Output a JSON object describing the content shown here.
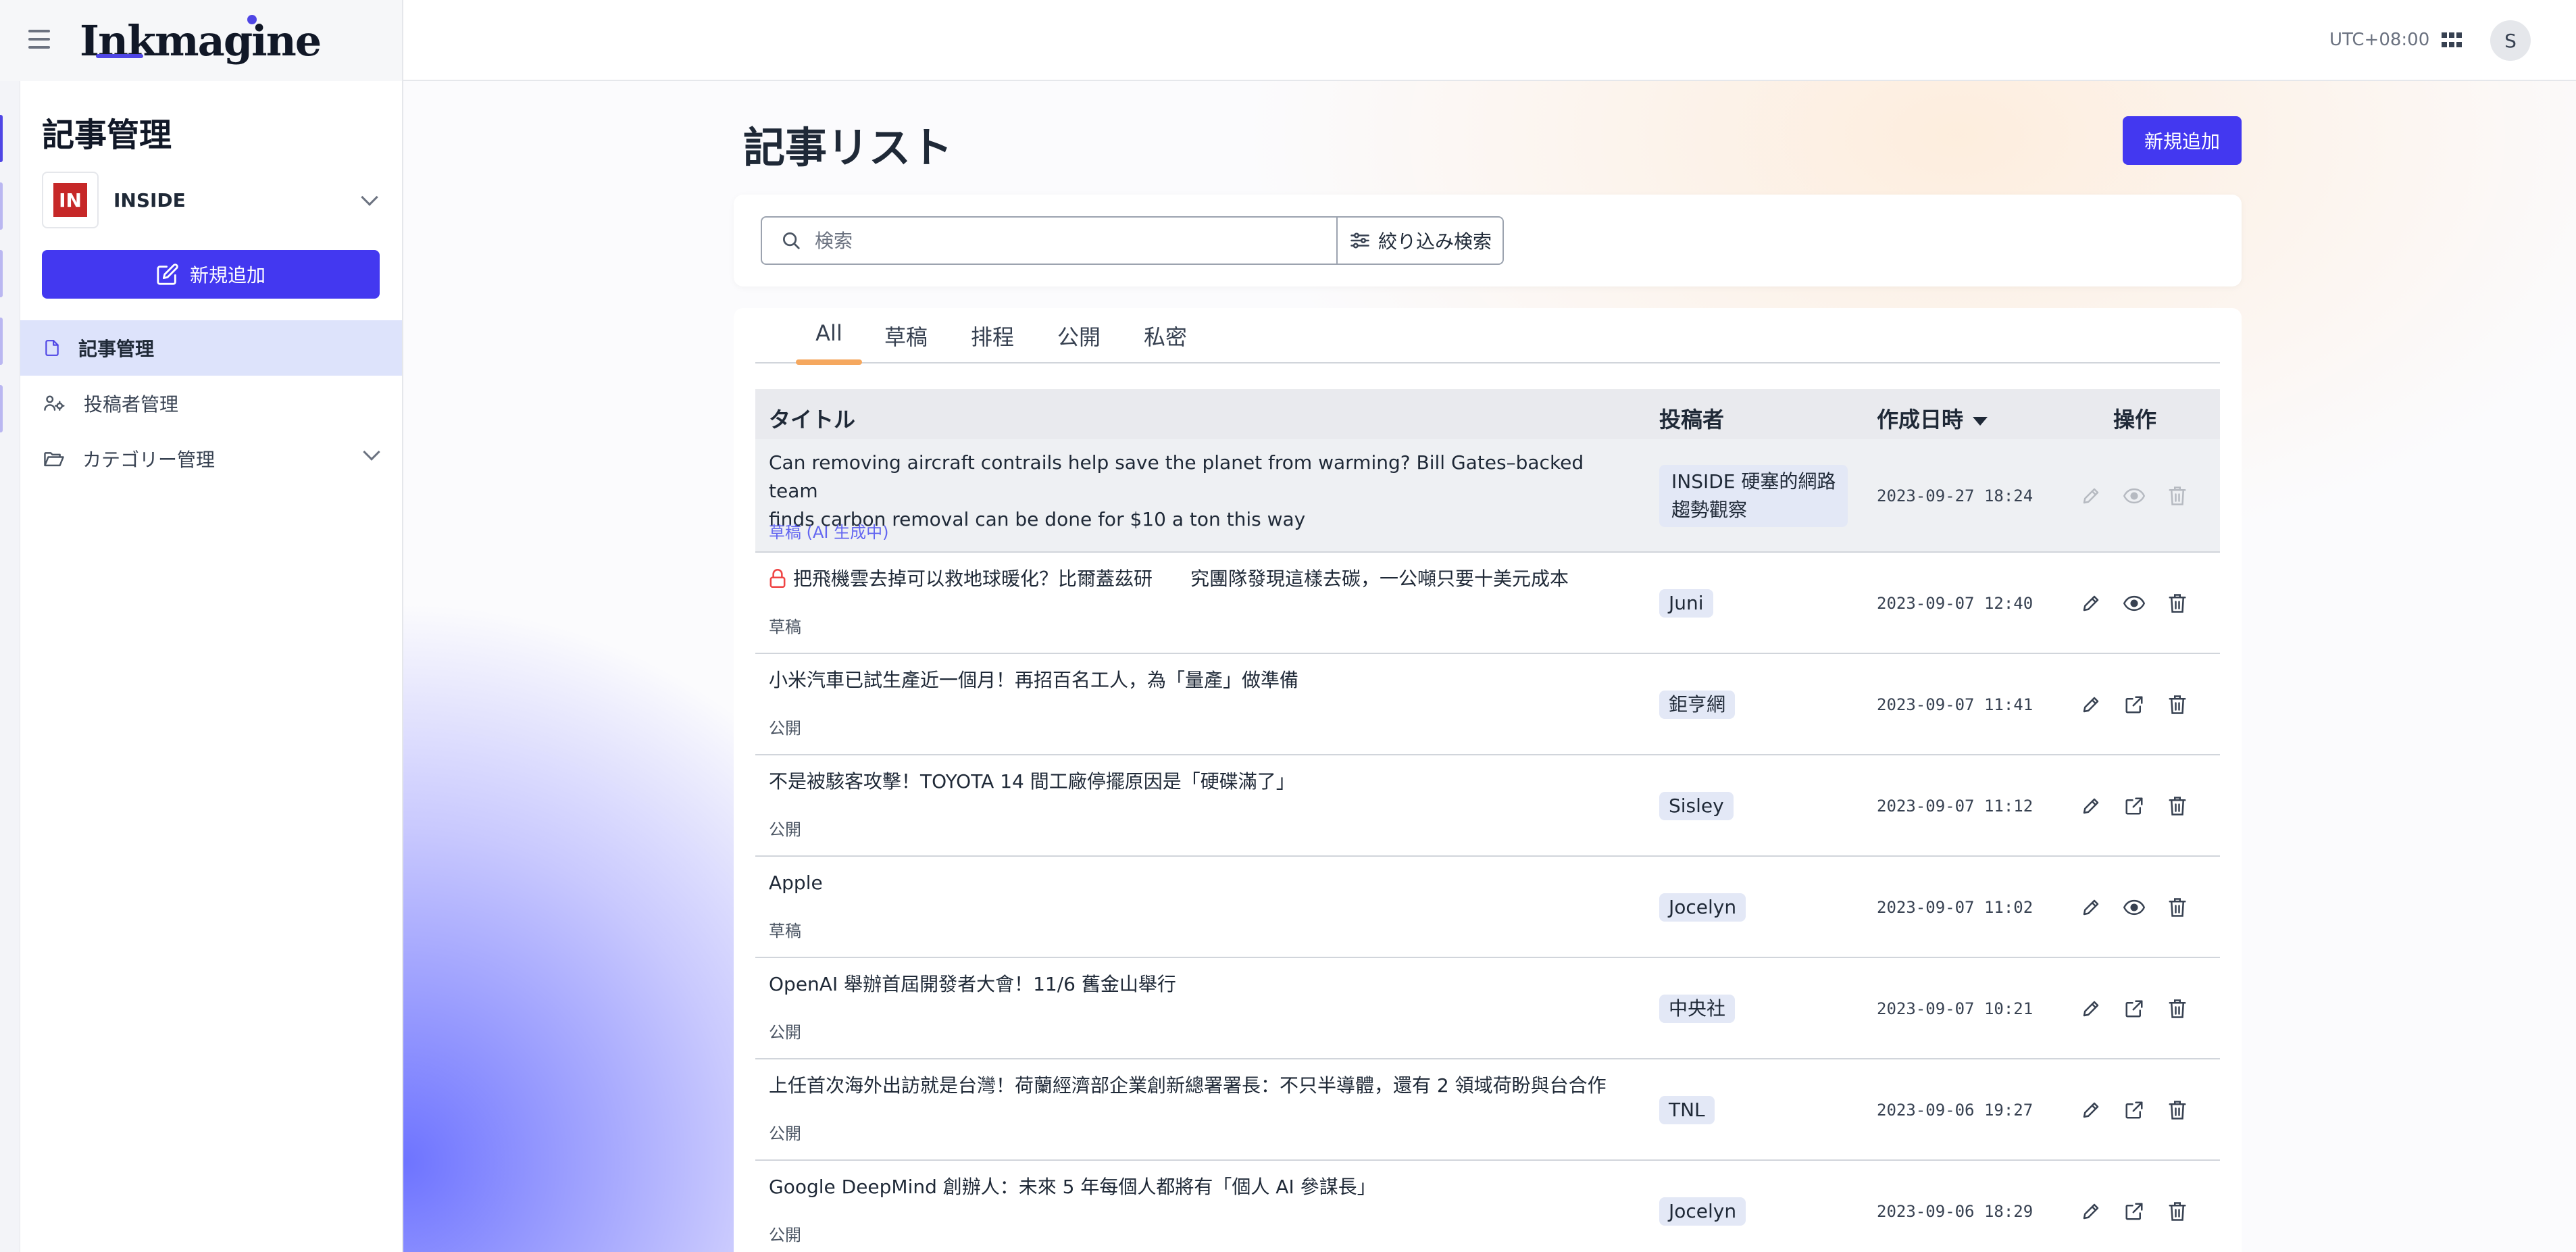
{
  "app": {
    "logo_text": "Inkmagine",
    "timezone": "UTC+08:00",
    "avatar_initial": "S"
  },
  "sidebar": {
    "title": "記事管理",
    "site": {
      "logo": "IN",
      "name": "INSIDE"
    },
    "new_button": "新規追加",
    "items": [
      {
        "label": "記事管理",
        "icon": "document-icon",
        "active": true
      },
      {
        "label": "投稿者管理",
        "icon": "users-gear-icon",
        "active": false
      },
      {
        "label": "カテゴリー管理",
        "icon": "folder-open-icon",
        "active": false
      }
    ]
  },
  "main": {
    "title": "記事リスト",
    "new_button": "新規追加",
    "search": {
      "placeholder": "検索",
      "value": ""
    },
    "filter_button": "絞り込み検索",
    "tabs": [
      {
        "label": "All",
        "active": true
      },
      {
        "label": "草稿",
        "active": false
      },
      {
        "label": "排程",
        "active": false
      },
      {
        "label": "公開",
        "active": false
      },
      {
        "label": "私密",
        "active": false
      }
    ],
    "columns": {
      "title": "タイトル",
      "author": "投稿者",
      "created": "作成日時",
      "actions": "操作"
    },
    "colors": {
      "accent": "#4338f0",
      "tab_indicator": "#f5a85f",
      "ai_status": "#6366f1",
      "lock": "#ef4444"
    },
    "rows": [
      {
        "title_line1": "Can removing aircraft contrails help save the planet from warming? Bill Gates–backed team",
        "title_line2": "finds carbon removal can be done for $10 a ton this way",
        "status": "草稿 (AI 生成中)",
        "author_line1": "INSIDE 硬塞的網路",
        "author_line2": "趨勢觀察",
        "date": "2023-09-27 18:24",
        "locked": false,
        "view_type": "preview",
        "disabled": true
      },
      {
        "title_line1": "把飛機雲去掉可以救地球暖化？比爾蓋茲研　　究團隊發現這樣去碳，一公噸只要十美元成本",
        "status": "草稿",
        "author_line1": "Juni",
        "date": "2023-09-07 12:40",
        "locked": true,
        "view_type": "preview",
        "disabled": false
      },
      {
        "title_line1": "小米汽車已試生產近一個月！再招百名工人，為「量產」做準備",
        "status": "公開",
        "author_line1": "鉅亨網",
        "date": "2023-09-07 11:41",
        "locked": false,
        "view_type": "external",
        "disabled": false
      },
      {
        "title_line1": "不是被駭客攻擊！TOYOTA 14 間工廠停擺原因是「硬碟滿了」",
        "status": "公開",
        "author_line1": "Sisley",
        "date": "2023-09-07 11:12",
        "locked": false,
        "view_type": "external",
        "disabled": false
      },
      {
        "title_line1": "Apple",
        "status": "草稿",
        "author_line1": "Jocelyn",
        "date": "2023-09-07 11:02",
        "locked": false,
        "view_type": "preview",
        "disabled": false
      },
      {
        "title_line1": "OpenAI 舉辦首屆開發者大會！11/6 舊金山舉行",
        "status": "公開",
        "author_line1": "中央社",
        "date": "2023-09-07 10:21",
        "locked": false,
        "view_type": "external",
        "disabled": false
      },
      {
        "title_line1": "上任首次海外出訪就是台灣！荷蘭經濟部企業創新總署署長：不只半導體，還有 2 領域荷盼與台合作",
        "status": "公開",
        "author_line1": "TNL",
        "date": "2023-09-06 19:27",
        "locked": false,
        "view_type": "external",
        "disabled": false
      },
      {
        "title_line1": "Google DeepMind 創辦人：未來 5 年每個人都將有「個人 AI 參謀長」",
        "status": "公開",
        "author_line1": "Jocelyn",
        "date": "2023-09-06 18:29",
        "locked": false,
        "view_type": "external",
        "disabled": false
      }
    ]
  }
}
